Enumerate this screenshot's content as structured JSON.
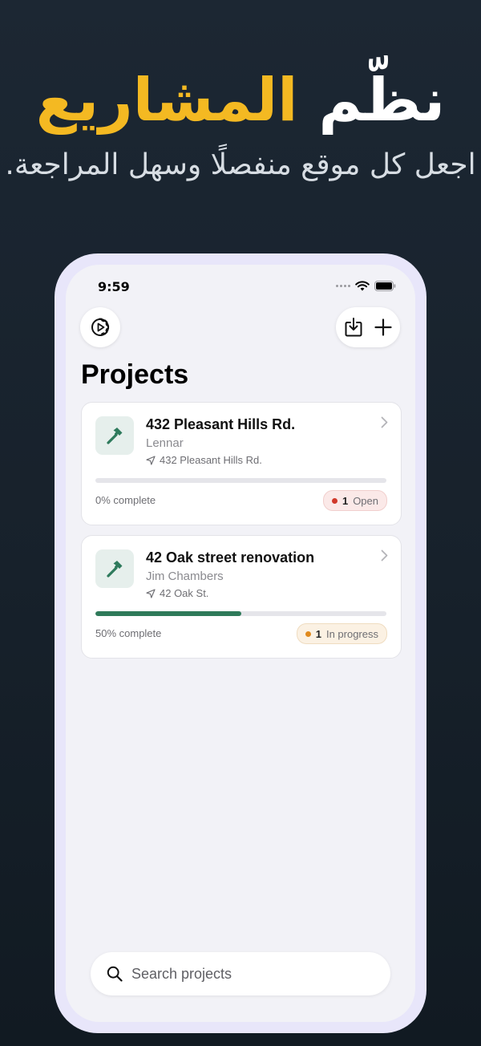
{
  "promo": {
    "headline_word1": "نظّم",
    "headline_word2": "المشاريع",
    "subtitle": "اجعل كل موقع منفصلًا وسهل المراجعة."
  },
  "status_bar": {
    "time": "9:59"
  },
  "toolbar": {
    "settings_icon": "gear-icon",
    "import_icon": "download-tray-icon",
    "add_icon": "plus-icon"
  },
  "page": {
    "title": "Projects"
  },
  "projects": [
    {
      "title": "432 Pleasant Hills Rd.",
      "client": "Lennar",
      "address": "432 Pleasant Hills Rd.",
      "progress_percent": 0,
      "progress_label": "0% complete",
      "status_count": "1",
      "status_label": "Open",
      "status_color": "#d0392b"
    },
    {
      "title": "42 Oak street renovation",
      "client": "Jim Chambers",
      "address": "42 Oak St.",
      "progress_percent": 50,
      "progress_label": "50% complete",
      "status_count": "1",
      "status_label": "In progress",
      "status_color": "#e08a1e"
    }
  ],
  "search": {
    "placeholder": "Search projects",
    "value": ""
  },
  "colors": {
    "accent_yellow": "#f4b922",
    "progress_green": "#2f7a5a",
    "device_frame": "#e8e6fa"
  }
}
